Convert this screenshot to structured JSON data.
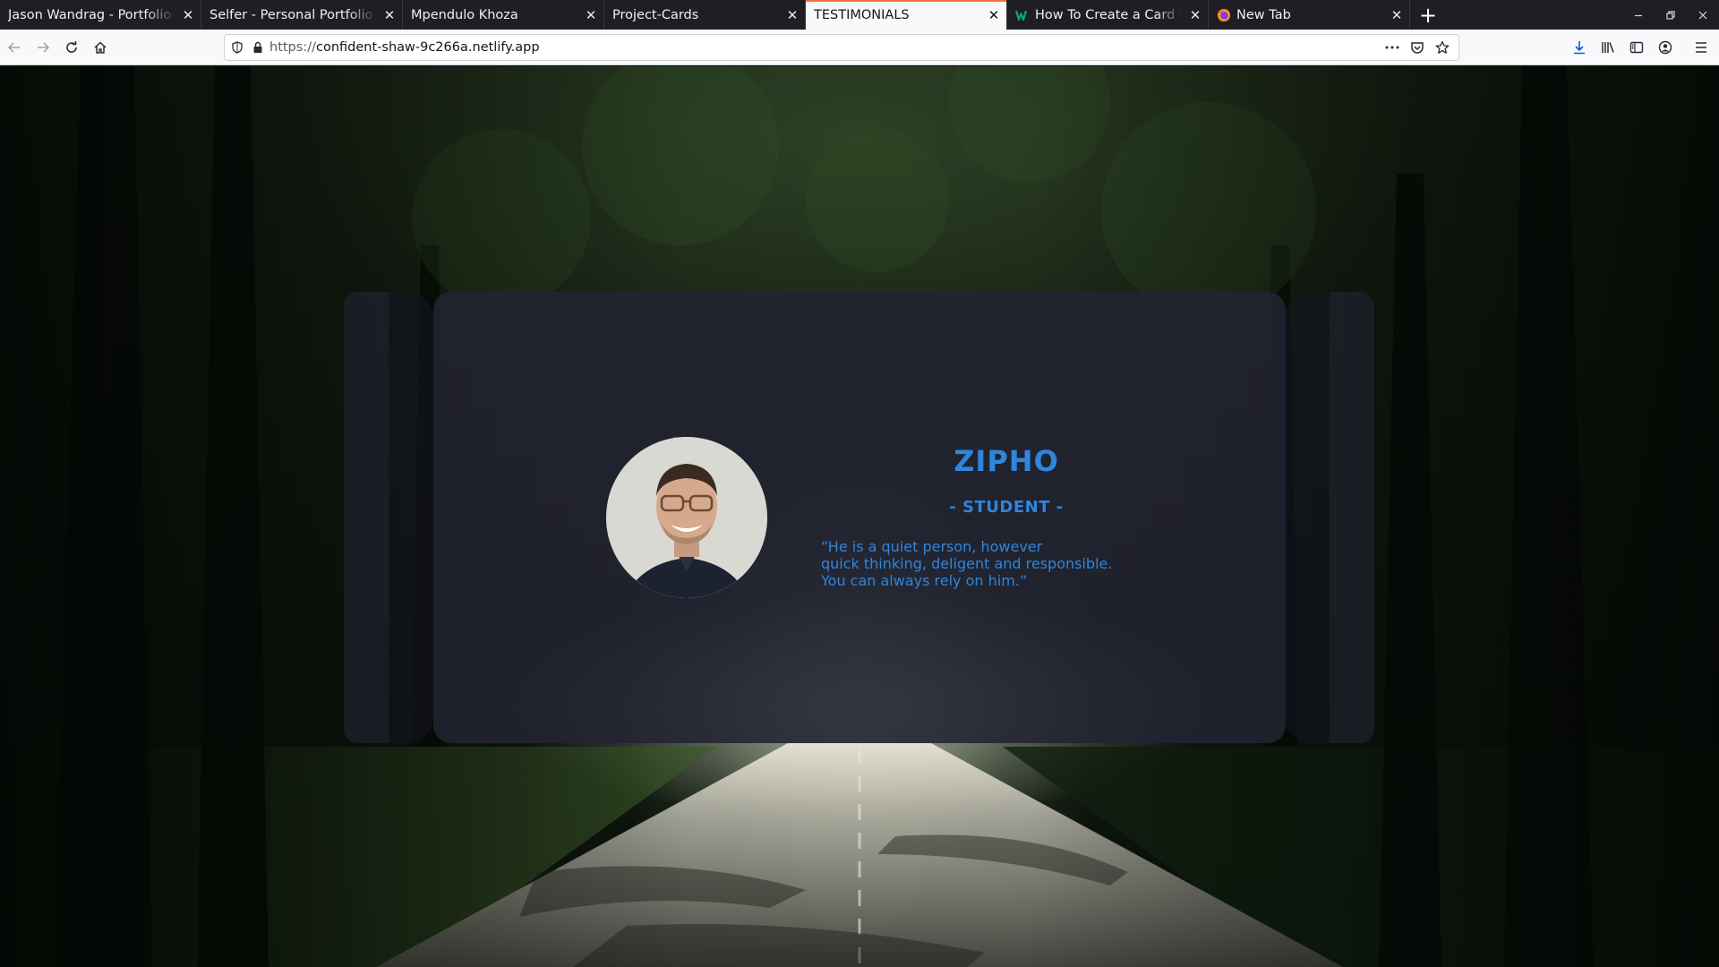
{
  "browser": {
    "tabs": [
      {
        "title": "Jason Wandrag - Portfolio",
        "favicon": "none",
        "active": false
      },
      {
        "title": "Selfer - Personal Portfolio Template",
        "favicon": "none",
        "active": false
      },
      {
        "title": "Mpendulo Khoza",
        "favicon": "none",
        "active": false
      },
      {
        "title": "Project-Cards",
        "favicon": "none",
        "active": false
      },
      {
        "title": "TESTIMONIALS",
        "favicon": "none",
        "active": true
      },
      {
        "title": "How To Create a Card with",
        "favicon": "w3schools-icon",
        "active": false
      },
      {
        "title": "New Tab",
        "favicon": "firefox-icon",
        "active": false
      }
    ],
    "close_glyph": "✕",
    "new_tab_glyph": "+",
    "url_protocol": "https://",
    "url_host": "confident-shaw-9c266a.netlify.app",
    "accent_color": "#ff7139"
  },
  "testimonial": {
    "name": "ZIPHO",
    "role": "- STUDENT -",
    "quote_lines": [
      "“He is a quiet person, however",
      "quick thinking, deligent and responsible.",
      "You can always rely on him.”"
    ],
    "text_color": "#2e86de"
  }
}
